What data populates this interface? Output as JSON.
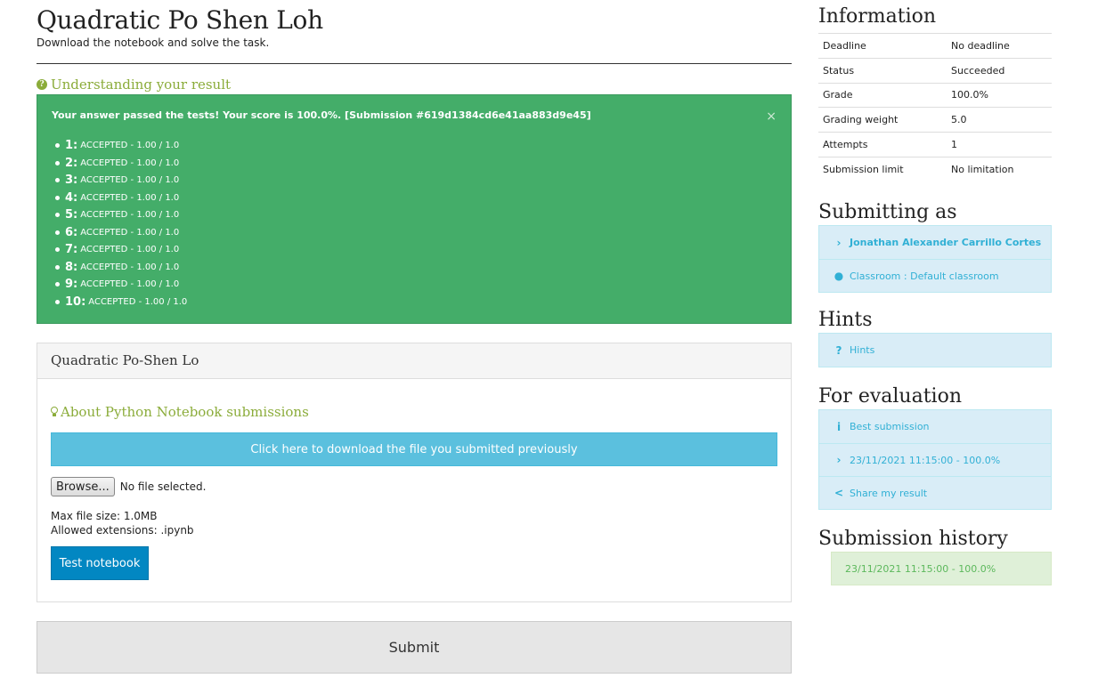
{
  "header": {
    "title": "Quadratic Po Shen Loh",
    "subtitle": "Download the notebook and solve the task."
  },
  "understanding": {
    "icon": "question-circle-icon",
    "label": "Understanding your result"
  },
  "result": {
    "message": "Your answer passed the tests! Your score is 100.0%. [Submission #619d1384cd6e41aa883d9e45]",
    "close": "×",
    "color": "#44ad69",
    "tests": [
      {
        "num": "1:",
        "status": "ACCEPTED - 1.00 / 1.0"
      },
      {
        "num": "2:",
        "status": "ACCEPTED - 1.00 / 1.0"
      },
      {
        "num": "3:",
        "status": "ACCEPTED - 1.00 / 1.0"
      },
      {
        "num": "4:",
        "status": "ACCEPTED - 1.00 / 1.0"
      },
      {
        "num": "5:",
        "status": "ACCEPTED - 1.00 / 1.0"
      },
      {
        "num": "6:",
        "status": "ACCEPTED - 1.00 / 1.0"
      },
      {
        "num": "7:",
        "status": "ACCEPTED - 1.00 / 1.0"
      },
      {
        "num": "8:",
        "status": "ACCEPTED - 1.00 / 1.0"
      },
      {
        "num": "9:",
        "status": "ACCEPTED - 1.00 / 1.0"
      },
      {
        "num": "10:",
        "status": "ACCEPTED - 1.00 / 1.0"
      }
    ]
  },
  "panel": {
    "title": "Quadratic Po-Shen Lo",
    "about_label": "About Python Notebook submissions",
    "about_icon": "lightbulb-icon",
    "download_label": "Click here to download the file you submitted previously",
    "browse_label": "Browse...",
    "file_status": "No file selected.",
    "max_size": "Max file size: 1.0MB",
    "extensions": "Allowed extensions: .ipynb",
    "test_label": "Test notebook"
  },
  "submit_label": "Submit",
  "sidebar": {
    "information": {
      "heading": "Information",
      "rows": [
        {
          "label": "Deadline",
          "value": "No deadline"
        },
        {
          "label": "Status",
          "value": "Succeeded"
        },
        {
          "label": "Grade",
          "value": "100.0%"
        },
        {
          "label": "Grading weight",
          "value": "5.0"
        },
        {
          "label": "Attempts",
          "value": "1"
        },
        {
          "label": "Submission limit",
          "value": "No limitation"
        }
      ]
    },
    "submitting_as": {
      "heading": "Submitting as",
      "user": "Jonathan Alexander Carrillo Cortes",
      "user_icon": "chevron-right-icon",
      "classroom": "Classroom : Default classroom",
      "classroom_icon": "users-icon"
    },
    "hints": {
      "heading": "Hints",
      "item": "Hints",
      "icon": "question-icon"
    },
    "evaluation": {
      "heading": "For evaluation",
      "best": "Best submission",
      "best_icon": "info-icon",
      "entry": "23/11/2021 11:15:00 - 100.0%",
      "entry_icon": "chevron-right-icon",
      "share": "Share my result",
      "share_icon": "share-icon"
    },
    "history": {
      "heading": "Submission history",
      "items": [
        "23/11/2021 11:15:00 - 100.0%"
      ]
    }
  }
}
